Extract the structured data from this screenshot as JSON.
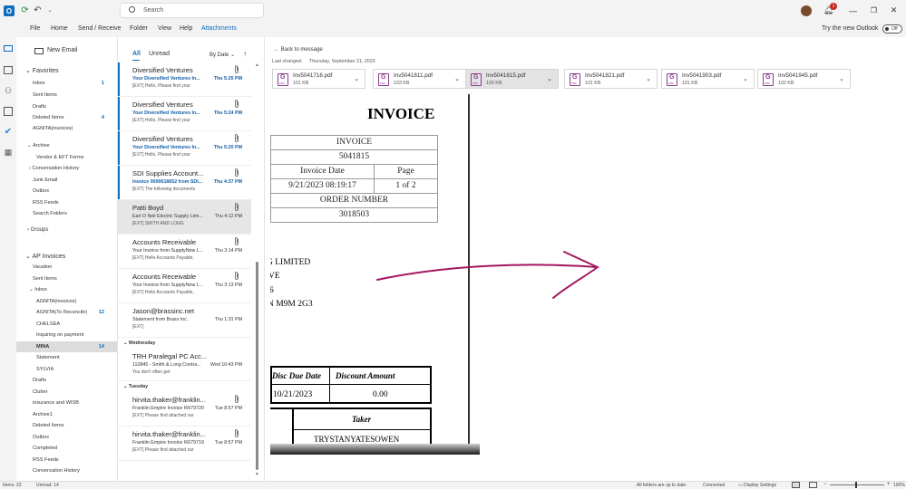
{
  "titlebar": {
    "search_placeholder": "Search",
    "notif_count": "1"
  },
  "menu": {
    "items": [
      "File",
      "Home",
      "Send / Receive",
      "Folder",
      "View",
      "Help",
      "Attachments"
    ],
    "try_new": "Try the new Outlook",
    "toggle": "Off"
  },
  "folders": {
    "new_email": "New Email",
    "favorites": "Favorites",
    "fav_items": [
      {
        "label": "Inbox",
        "count": "1"
      },
      {
        "label": "Sent Items",
        "count": ""
      },
      {
        "label": "Drafts",
        "count": ""
      },
      {
        "label": "Deleted Items",
        "count": "4"
      },
      {
        "label": "AGNITA(invoices)",
        "count": ""
      }
    ],
    "archive": "Archive",
    "archive_items": [
      "Vendor & EFT Forms",
      "Conversation History",
      "Junk Email",
      "Outbox",
      "RSS Feeds",
      "Search Folders"
    ],
    "groups": "Groups",
    "ap": "AP Invoices",
    "ap_items": [
      "Vacation",
      "Sent Items",
      "Inbox"
    ],
    "inbox_sub": [
      {
        "label": "AGNITA(invoices)",
        "count": ""
      },
      {
        "label": "AGNITA(To Reconcile)",
        "count": "12"
      },
      {
        "label": "CHELSEA",
        "count": ""
      },
      {
        "label": "Inquiring on payment",
        "count": ""
      },
      {
        "label": "MINA",
        "count": "14"
      },
      {
        "label": "Statement",
        "count": ""
      },
      {
        "label": "SYLVIA",
        "count": ""
      }
    ],
    "more_items": [
      "Drafts",
      "Clutter",
      "insurance and WISB",
      "Archive1",
      "Deleted Items",
      "Outbox",
      "Completed",
      "RSS Feeds",
      "Conversation History"
    ]
  },
  "list": {
    "tab_all": "All",
    "tab_unread": "Unread",
    "sort": "By Date",
    "messages": [
      {
        "sender": "Diversified Ventures",
        "subject": "Your Diversified Ventures In...",
        "time": "Thu 5:25 PM",
        "preview": "[EXT] Hello,  Please find your",
        "unread": true
      },
      {
        "sender": "Diversified Ventures",
        "subject": "Your Diversified Ventures In...",
        "time": "Thu 5:24 PM",
        "preview": "[EXT] Hello,  Please find your",
        "unread": true
      },
      {
        "sender": "Diversified Ventures",
        "subject": "Your Diversified Ventures In...",
        "time": "Thu 5:20 PM",
        "preview": "[EXT] Hello,  Please find your",
        "unread": true
      },
      {
        "sender": "SDI Supplies Account...",
        "subject": "Invoice 0000618652 from SDI...",
        "time": "Thu 4:37 PM",
        "preview": "[EXT] The following documents",
        "unread": true
      },
      {
        "sender": "Patti Boyd",
        "subject": "Earl O Neil Electric Supply Limi...",
        "time": "Thu 4:12 PM",
        "preview": "[EXT]  SMITH AND LONG",
        "unread": false
      },
      {
        "sender": "Accounts Receivable",
        "subject": "Your Invoice from SupplyNow L...",
        "time": "Thu 3:14 PM",
        "preview": "[EXT] Hello Accounts Payable,",
        "unread": false
      },
      {
        "sender": "Accounts Receivable",
        "subject": "Your Invoice from SupplyNow L...",
        "time": "Thu 3:13 PM",
        "preview": "[EXT] Hello Accounts Payable,",
        "unread": false
      },
      {
        "sender": "Jason@brassinc.net",
        "subject": "Statement from Brass Inc.",
        "time": "Thu 1:31 PM",
        "preview": "[EXT]",
        "unread": false
      }
    ],
    "group_wed": "Wednesday",
    "wed_msg": {
      "sender": "TRH Paralegal PC Acc...",
      "subject": "110845 - Smith & Long Contra...",
      "time": "Wed 10:43 PM",
      "preview": "You don't often get"
    },
    "group_tue": "Tuesday",
    "tue_msgs": [
      {
        "sender": "hirvita.thaker@franklin...",
        "subject": "Franklin Empire Invoice I6679720",
        "time": "Tue 8:57 PM",
        "preview": "[EXT] Please find attached our"
      },
      {
        "sender": "hirvita.thaker@franklin...",
        "subject": "Franklin Empire Invoice I6679719",
        "time": "Tue 8:57 PM",
        "preview": "[EXT] Please find attached our"
      }
    ]
  },
  "reading": {
    "back": "Back to message",
    "last_changed_label": "Last changed:",
    "last_changed": "Thursday, September 21, 2023",
    "attachments": [
      {
        "name": "Inv5041716.pdf",
        "size": "101 KB"
      },
      {
        "name": "Inv5041811.pdf",
        "size": "103 KB"
      },
      {
        "name": "Inv5041815.pdf",
        "size": "100 KB"
      },
      {
        "name": "Inv5041821.pdf",
        "size": "101 KB"
      },
      {
        "name": "Inv5041903.pdf",
        "size": "101 KB"
      },
      {
        "name": "Inv5041945.pdf",
        "size": "102 KB"
      }
    ]
  },
  "invoice": {
    "title": "INVOICE",
    "label_invoice": "INVOICE",
    "number": "5041815",
    "label_date": "Invoice Date",
    "label_page": "Page",
    "date": "9/21/2023 08:19:17",
    "page": "1 of 2",
    "label_order": "ORDER NUMBER",
    "order": "3018503",
    "addr1": "G LIMITED",
    "addr2": "VE",
    "addr3": "6",
    "addr4": "N M9M 2G3",
    "label_disc_due": "Disc Due Date",
    "label_disc_amt": "Discount Amount",
    "disc_due": "10/21/2023",
    "disc_amt": "0.00",
    "label_taker": "Taker",
    "taker": "TRYSTANYATESOWEN"
  },
  "status": {
    "items": "Items: 22",
    "unread": "Unread: 14",
    "sync": "All folders are up to date.",
    "connected": "Connected",
    "display": "Display Settings",
    "zoom": "100%"
  },
  "colors": {
    "accent": "#0f6cbd",
    "annotation": "#a3175f",
    "pdf": "#8a3b8f"
  }
}
